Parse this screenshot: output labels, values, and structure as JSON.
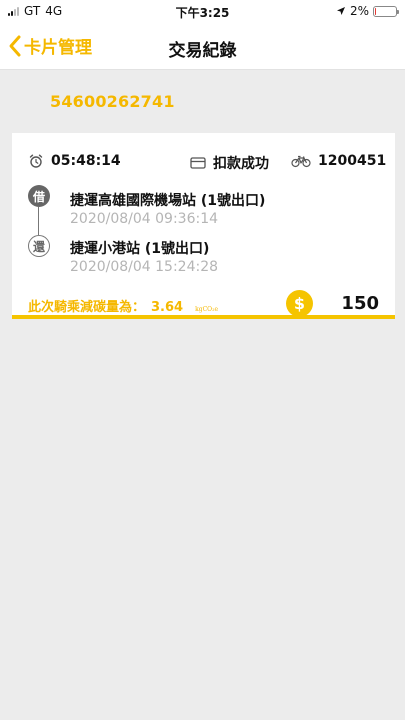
{
  "status_bar": {
    "carrier": "GT",
    "network": "4G",
    "time": "下午3:25",
    "battery_text": "2%",
    "battery_level": 0.02,
    "battery_color": "#e53935"
  },
  "nav": {
    "back_label": "卡片管理",
    "title": "交易紀錄",
    "back_icon": "chevron-left-icon"
  },
  "card_number": "54600262741",
  "transaction": {
    "duration": "05:48:14",
    "duration_icon": "alarm-clock-icon",
    "payment_status": "扣款成功",
    "payment_icon": "credit-card-icon",
    "bike_id": "1200451",
    "bike_icon": "bicycle-icon",
    "borrow": {
      "badge": "借",
      "station": "捷運高雄國際機場站 (1號出口)",
      "time": "2020/08/04 09:36:14"
    },
    "return": {
      "badge": "還",
      "station": "捷運小港站 (1號出口)",
      "time": "2020/08/04 15:24:28"
    },
    "carbon_label": "此次騎乘減碳量為：",
    "carbon_value": "3.64",
    "carbon_unit": "kgCO₂e",
    "coin_symbol": "$",
    "coin_icon": "dollar-coin-icon",
    "amount": "150"
  },
  "colors": {
    "accent": "#f5b800",
    "background": "#ececec",
    "card": "#ffffff"
  }
}
